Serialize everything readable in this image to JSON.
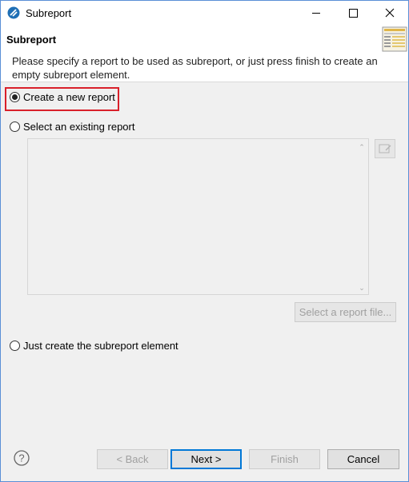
{
  "window": {
    "title": "Subreport"
  },
  "header": {
    "title": "Subreport",
    "description": "Please specify a report to be used as subreport, or just press finish to create an empty subreport element."
  },
  "options": {
    "create_new": "Create a new report",
    "select_existing": "Select an existing report",
    "just_create": "Just create the subreport element",
    "selected": "create_new"
  },
  "select_file_label": "Select a report file...",
  "buttons": {
    "back": "< Back",
    "next": "Next >",
    "finish": "Finish",
    "cancel": "Cancel"
  },
  "colors": {
    "highlight": "#d9202a",
    "accent": "#0078d7"
  },
  "icons": [
    "app-icon",
    "wizard-icon",
    "help-icon",
    "browse-icon"
  ]
}
